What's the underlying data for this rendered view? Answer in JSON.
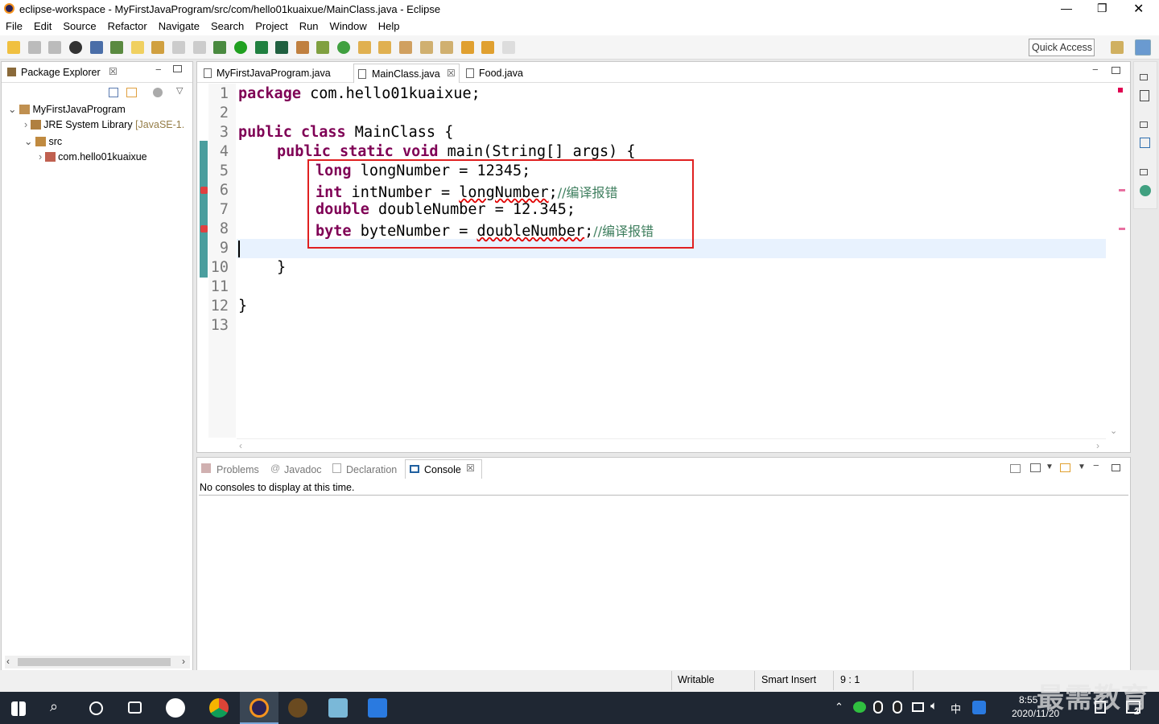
{
  "window": {
    "title": "eclipse-workspace - MyFirstJavaProgram/src/com/hello01kuaixue/MainClass.java - Eclipse"
  },
  "menu": [
    "File",
    "Edit",
    "Source",
    "Refactor",
    "Navigate",
    "Search",
    "Project",
    "Run",
    "Window",
    "Help"
  ],
  "quick_access": "Quick Access",
  "package_explorer": {
    "tab": "Package Explorer",
    "tree": {
      "project": "MyFirstJavaProgram",
      "jre": "JRE System Library",
      "jre_version": "[JavaSE-1.",
      "src": "src",
      "package": "com.hello01kuaixue"
    }
  },
  "editor": {
    "tabs": [
      "MyFirstJavaProgram.java",
      "MainClass.java",
      "Food.java"
    ],
    "line_numbers": [
      "1",
      "2",
      "3",
      "4",
      "5",
      "6",
      "7",
      "8",
      "9",
      "10",
      "11",
      "12",
      "13"
    ],
    "code": {
      "l1_kw": "package",
      "l1_rest": " com.hello01kuaixue;",
      "l3_kw1": "public",
      "l3_kw2": "class",
      "l3_rest": " MainClass {",
      "l4_kw1": "public",
      "l4_kw2": "static",
      "l4_kw3": "void",
      "l4_rest": " main(String[] args) {",
      "l5_kw": "long",
      "l5_rest": " longNumber = 12345;",
      "l6_kw": "int",
      "l6_mid": " intNumber = ",
      "l6_err": "longNumber",
      "l6_semi": ";",
      "l6_comment": "//编译报错",
      "l7_kw": "double",
      "l7_rest": " doubleNumber = 12.345;",
      "l8_kw": "byte",
      "l8_mid": " byteNumber = ",
      "l8_err": "doubleNumber",
      "l8_semi": ";",
      "l8_comment": "//编译报错",
      "l10": "}",
      "l12": "}"
    }
  },
  "bottom": {
    "tabs": [
      "Problems",
      "Javadoc",
      "Declaration",
      "Console"
    ],
    "message": "No consoles to display at this time."
  },
  "status": {
    "writable": "Writable",
    "insert": "Smart Insert",
    "position": "9 : 1"
  },
  "taskbar": {
    "time": "8:55",
    "date": "2020/11/20",
    "ime": "中",
    "watermark": "最需教育",
    "notif": "2"
  },
  "colors": {
    "keyword": "#7f0055",
    "comment": "#3f7f5f",
    "highlight_box": "#e02020",
    "taskbar": "#1f2733"
  }
}
